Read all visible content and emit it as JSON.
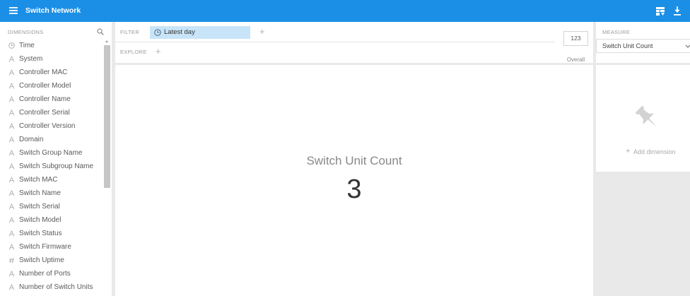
{
  "app": {
    "title": "Switch Network"
  },
  "icons": {
    "menu": "hamburger-menu-icon",
    "toolbar": [
      "table-view-icon",
      "download-icon"
    ],
    "search": "search-icon",
    "pin": "pin-icon",
    "dropdown": "chevron-down-icon",
    "scroll": "scroll-up-arrow"
  },
  "dimensions": {
    "header": "DIMENSIONS",
    "items": [
      {
        "label": "Time",
        "icon": "clock-icon"
      },
      {
        "label": "System",
        "icon": "string-type-icon"
      },
      {
        "label": "Controller MAC",
        "icon": "string-type-icon"
      },
      {
        "label": "Controller Model",
        "icon": "string-type-icon"
      },
      {
        "label": "Controller Name",
        "icon": "string-type-icon"
      },
      {
        "label": "Controller Serial",
        "icon": "string-type-icon"
      },
      {
        "label": "Controller Version",
        "icon": "string-type-icon"
      },
      {
        "label": "Domain",
        "icon": "string-type-icon"
      },
      {
        "label": "Switch Group Name",
        "icon": "string-type-icon"
      },
      {
        "label": "Switch Subgroup Name",
        "icon": "string-type-icon"
      },
      {
        "label": "Switch MAC",
        "icon": "string-type-icon"
      },
      {
        "label": "Switch Name",
        "icon": "string-type-icon"
      },
      {
        "label": "Switch Serial",
        "icon": "string-type-icon"
      },
      {
        "label": "Switch Model",
        "icon": "string-type-icon"
      },
      {
        "label": "Switch Status",
        "icon": "string-type-icon"
      },
      {
        "label": "Switch Firmware",
        "icon": "string-type-icon"
      },
      {
        "label": "Switch Uptime",
        "icon": "number-type-icon"
      },
      {
        "label": "Number of Ports",
        "icon": "string-type-icon"
      },
      {
        "label": "Number of Switch Units",
        "icon": "string-type-icon"
      }
    ]
  },
  "filter": {
    "label": "FILTER",
    "pill_label": "Latest day",
    "pill_icon": "clock-icon",
    "add": "+"
  },
  "explore": {
    "label": "EXPLORE",
    "add": "+"
  },
  "totals": {
    "value": "123",
    "label": "Overall"
  },
  "measure": {
    "label": "MEASURE",
    "selected": "Switch Unit Count"
  },
  "pinboard": {
    "add": "+",
    "add_label": "Add dimension"
  },
  "visualization": {
    "title": "Switch Unit Count",
    "value": 3
  },
  "colors": {
    "topbar": "#1b8fe6",
    "filter_pill": "#c8e4f8",
    "background": "#e9e9e9"
  }
}
